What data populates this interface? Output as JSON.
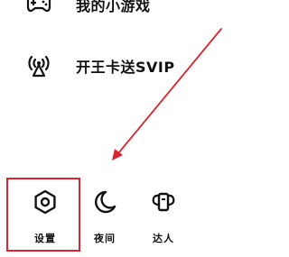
{
  "menu": {
    "items": [
      {
        "label": "我的小游戏",
        "icon": "gamepad-icon"
      },
      {
        "label": "开王卡送SVIP",
        "icon": "wireless-broadcast-icon"
      }
    ]
  },
  "toolbar": {
    "items": [
      {
        "label": "设置",
        "icon": "hexagon-gear-icon"
      },
      {
        "label": "夜间",
        "icon": "crescent-moon-icon"
      },
      {
        "label": "达人",
        "icon": "winged-badge-icon"
      }
    ]
  },
  "annotation": {
    "color": "#d9252f",
    "highlighted_item": "设置"
  }
}
